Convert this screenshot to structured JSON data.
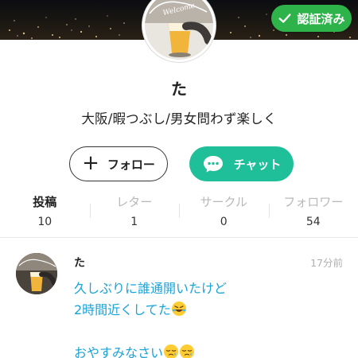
{
  "profile": {
    "name": "た",
    "bio": "大阪/暇つぶし/男女問わず楽しく",
    "verified_label": "認証済み",
    "avatar_caption": "Welcome"
  },
  "actions": {
    "follow_label": "フォロー",
    "chat_label": "チャット"
  },
  "stats": [
    {
      "label": "投稿",
      "value": "10"
    },
    {
      "label": "レター",
      "value": "1"
    },
    {
      "label": "サークル",
      "value": "0"
    },
    {
      "label": "フォロワー",
      "value": "54"
    }
  ],
  "post": {
    "author": "た",
    "time": "17分前",
    "line1": "久しぶりに誰通開いたけど",
    "line2": "2時間近くしてた",
    "line3": "おやすみなさい",
    "emoji_line2": "rolling-on-floor-laughing-icon",
    "emoji_line3": "sleepy-face-icon"
  },
  "colors": {
    "verified": "#2db34a",
    "chat": "#1fbf9a",
    "post_text": "#1aa3d8"
  }
}
